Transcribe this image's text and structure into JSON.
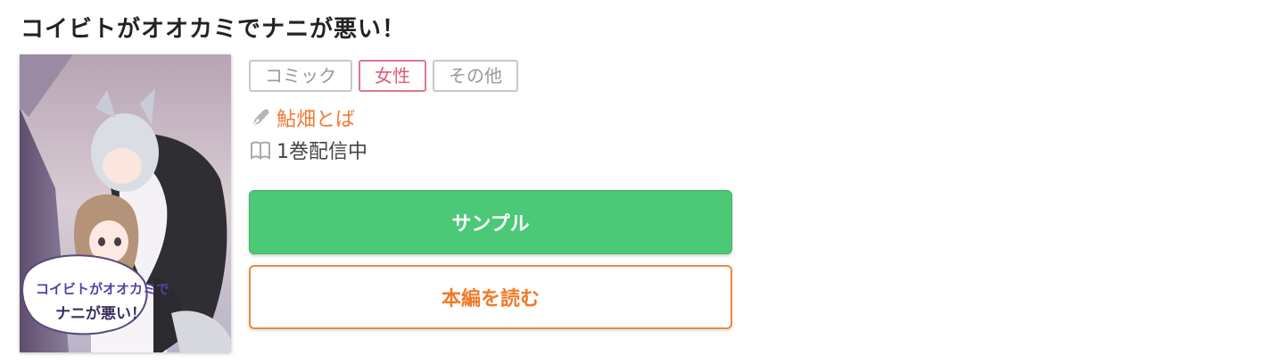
{
  "title": "コイビトがオオカミでナニが悪い！",
  "cover": {
    "alt": "コイビトがオオカミでナニが悪い！ cover",
    "logo_lines": [
      "コイビトがオオカミで",
      "ナニが悪い！"
    ]
  },
  "tags": [
    {
      "label": "コミック"
    },
    {
      "label": "女性"
    },
    {
      "label": "その他"
    }
  ],
  "author": {
    "icon": "pen-icon",
    "name": "鮎畑とば"
  },
  "volume": {
    "icon": "book-icon",
    "text": "1巻配信中"
  },
  "buttons": {
    "sample_label": "サンプル",
    "read_label": "本編を読む"
  },
  "colors": {
    "sample_bg": "#4cc976",
    "read_accent": "#f07a28",
    "author_link": "#f07a35",
    "female_tag": "#e05a78"
  }
}
